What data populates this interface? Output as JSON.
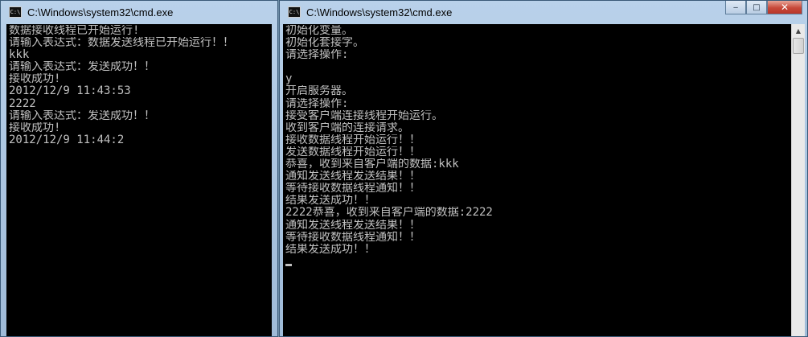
{
  "left_window": {
    "title": "C:\\Windows\\system32\\cmd.exe",
    "icon": "cmd-icon",
    "lines": [
      "数据接收线程已开始运行!",
      "请输入表达式：数据发送线程已开始运行！！",
      "kkk",
      "请输入表达式：发送成功！！",
      "接收成功!",
      "2012/12/9 11:43:53",
      "2222",
      "请输入表达式：发送成功！！",
      "接收成功!",
      "2012/12/9 11:44:2"
    ]
  },
  "right_window": {
    "title": "C:\\Windows\\system32\\cmd.exe",
    "icon": "cmd-icon",
    "controls": {
      "minimize": "minimize-icon",
      "maximize": "maximize-icon",
      "close": "close-icon"
    },
    "lines": [
      "初始化变量。",
      "初始化套接字。",
      "请选择操作:",
      "",
      "y",
      "开启服务器。",
      "请选择操作:",
      "接受客户端连接线程开始运行。",
      "收到客户端的连接请求。",
      "接收数据线程开始运行！！",
      "发送数据线程开始运行！！",
      "恭喜，收到来自客户端的数据:kkk",
      "通知发送线程发送结果！！",
      "等待接收数据线程通知！！",
      "结果发送成功！！",
      "2222恭喜，收到来自客户端的数据:2222",
      "通知发送线程发送结果！！",
      "等待接收数据线程通知！！",
      "结果发送成功！！"
    ]
  },
  "colors": {
    "console_bg": "#000000",
    "console_text": "#c0c0c0",
    "titlebar": "#b9d1ea"
  }
}
